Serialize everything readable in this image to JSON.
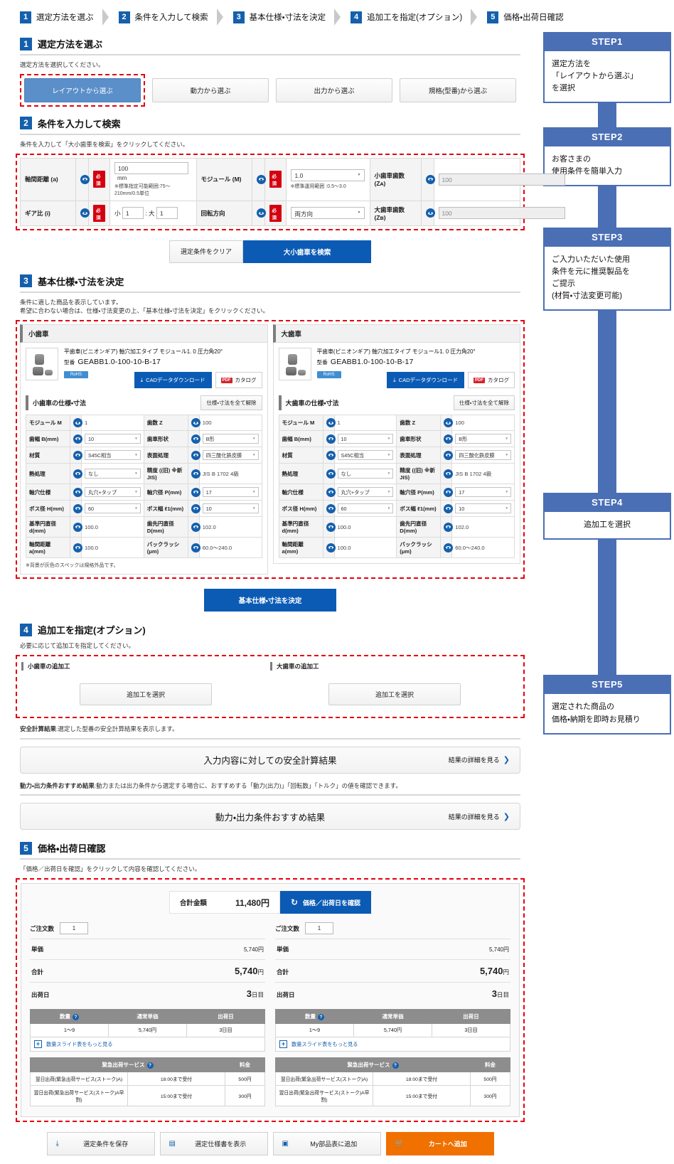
{
  "breadcrumb": {
    "steps": [
      {
        "num": "1",
        "label": "選定方法を選ぶ"
      },
      {
        "num": "2",
        "label": "条件を入力して検索"
      },
      {
        "num": "3",
        "label": "基本仕様・寸法を決定"
      },
      {
        "num": "4",
        "label": "追加工を指定(オプション)"
      },
      {
        "num": "5",
        "label": "価格・出荷日確認"
      }
    ]
  },
  "section1": {
    "num": "1",
    "title": "選定方法を選ぶ",
    "note": "選定方法を選択してください。",
    "methods": [
      {
        "label": "レイアウトから選ぶ",
        "selected": true
      },
      {
        "label": "動力から選ぶ",
        "selected": false
      },
      {
        "label": "出力から選ぶ",
        "selected": false
      },
      {
        "label": "規格(型番)から選ぶ",
        "selected": false
      }
    ]
  },
  "section2": {
    "num": "2",
    "title": "条件を入力して検索",
    "note": "条件を入力して「大小歯車を検索」をクリックしてください。",
    "required_badge": "必須",
    "fields": {
      "axis_distance": {
        "label": "軸間距離 (a)",
        "value": "100",
        "unit": "mm",
        "hint": "※標準指定可能範囲:75〜210mm/0.5単位"
      },
      "module": {
        "label": "モジュール (M)",
        "value": "1.0",
        "hint": "※標準運用範囲 :0.5〜3.0"
      },
      "small_teeth": {
        "label": "小歯車歯数 (Zᴀ)",
        "value": "100"
      },
      "gear_ratio": {
        "label": "ギア比 (i)",
        "small_prefix": "小",
        "small_value": "1",
        "sep": ": 大",
        "large_value": "1"
      },
      "rotation": {
        "label": "回転方向",
        "value": "両方向"
      },
      "large_teeth": {
        "label": "大歯車歯数 (Zʙ)",
        "value": "100"
      }
    },
    "buttons": {
      "clear": "選定条件をクリア",
      "search": "大小歯車を検索"
    }
  },
  "section3": {
    "num": "3",
    "title": "基本仕様・寸法を決定",
    "note_line1": "条件に適した商品を表示しています。",
    "note_line2": "希望に合わない場合は、仕様・寸法変更の上、「基本仕様・寸法を決定」をクリックください。",
    "decide_button": "基本仕様・寸法を決定",
    "footnote": "※背景が灰色のスペックは規格外品です。",
    "gears": [
      {
        "title": "小歯車",
        "desc": "平歯車(ピニオンギア) 軸穴加工タイプ モジュール1. 0 圧力角20°",
        "model_label": "型番",
        "model": "GEABB1.0-100-10-B-17",
        "rohs": "RoHS",
        "cad_button": "CADデータダウンロード",
        "catalog_button": "カタログ",
        "spec_title": "小歯車の仕様・寸法",
        "clear_spec": "仕様・寸法を全て解除",
        "specs": [
          {
            "l_label": "モジュール M",
            "l_value": "1",
            "l_type": "text",
            "r_label": "歯数 Z",
            "r_value": "100",
            "r_type": "text"
          },
          {
            "l_label": "歯幅 B(mm)",
            "l_value": "10",
            "l_type": "select",
            "r_label": "歯車形状",
            "r_value": "B形",
            "r_type": "select"
          },
          {
            "l_label": "材質",
            "l_value": "S45C相当",
            "l_type": "select",
            "r_label": "表面処理",
            "r_value": "四三酸化鉄皮膜",
            "r_type": "select"
          },
          {
            "l_label": "熱処理",
            "l_value": "なし",
            "l_type": "select",
            "r_label": "精度 ((旧) ※新JIS)",
            "r_value": "JIS B 1702 4級",
            "r_type": "text"
          },
          {
            "l_label": "軸穴仕様",
            "l_value": "丸穴+タップ",
            "l_type": "select",
            "r_label": "軸穴径 P(mm)",
            "r_value": "17",
            "r_type": "select"
          },
          {
            "l_label": "ボス径 H(mm)",
            "l_value": "60",
            "l_type": "select",
            "r_label": "ボス幅 ℓ1(mm)",
            "r_value": "10",
            "r_type": "select"
          },
          {
            "l_label": "基準円直径 d(mm)",
            "l_value": "100.0",
            "l_type": "text",
            "r_label": "歯先円直径 D(mm)",
            "r_value": "102.0",
            "r_type": "text"
          },
          {
            "l_label": "軸間距離 a(mm)",
            "l_value": "100.0",
            "l_type": "text",
            "r_label": "バックラッシ (μm)",
            "r_value": "60.0〜240.0",
            "r_type": "text"
          }
        ]
      },
      {
        "title": "大歯車",
        "desc": "平歯車(ピニオンギア) 軸穴加工タイプ モジュール1. 0 圧力角20°",
        "model_label": "型番",
        "model": "GEABB1.0-100-10-B-17",
        "rohs": "RoHS",
        "cad_button": "CADデータダウンロード",
        "catalog_button": "カタログ",
        "spec_title": "大歯車の仕様・寸法",
        "clear_spec": "仕様・寸法を全て解除",
        "specs": [
          {
            "l_label": "モジュール M",
            "l_value": "1",
            "l_type": "text",
            "r_label": "歯数 Z",
            "r_value": "100",
            "r_type": "text"
          },
          {
            "l_label": "歯幅 B(mm)",
            "l_value": "10",
            "l_type": "select",
            "r_label": "歯車形状",
            "r_value": "B形",
            "r_type": "select"
          },
          {
            "l_label": "材質",
            "l_value": "S45C相当",
            "l_type": "select",
            "r_label": "表面処理",
            "r_value": "四三酸化鉄皮膜",
            "r_type": "select"
          },
          {
            "l_label": "熱処理",
            "l_value": "なし",
            "l_type": "select",
            "r_label": "精度 ((旧) ※新JIS)",
            "r_value": "JIS B 1702 4級",
            "r_type": "text"
          },
          {
            "l_label": "軸穴仕様",
            "l_value": "丸穴+タップ",
            "l_type": "select",
            "r_label": "軸穴径 P(mm)",
            "r_value": "17",
            "r_type": "select"
          },
          {
            "l_label": "ボス径 H(mm)",
            "l_value": "60",
            "l_type": "select",
            "r_label": "ボス幅 ℓ1(mm)",
            "r_value": "10",
            "r_type": "select"
          },
          {
            "l_label": "基準円直径 d(mm)",
            "l_value": "100.0",
            "l_type": "text",
            "r_label": "歯先円直径 D(mm)",
            "r_value": "102.0",
            "r_type": "text"
          },
          {
            "l_label": "軸間距離 a(mm)",
            "l_value": "100.0",
            "l_type": "text",
            "r_label": "バックラッシ (μm)",
            "r_value": "60.0〜240.0",
            "r_type": "text"
          }
        ]
      }
    ]
  },
  "section4": {
    "num": "4",
    "title": "追加工を指定(オプション)",
    "note": "必要に応じて追加工を指定してください。",
    "small_title": "小歯車の追加工",
    "large_title": "大歯車の追加工",
    "select_button": "追加工を選択"
  },
  "results": {
    "safety_note_bold": "安全計算結果",
    "safety_note_rest": ":選定した型番の安全計算結果を表示します。",
    "safety_title": "入力内容に対しての安全計算結果",
    "safety_more": "結果の詳細を見る",
    "power_note_bold": "動力・出力条件おすすめ結果",
    "power_note_rest": ":動力または出力条件から選定する場合に、おすすめする「動力(出力)」「回転数」「トルク」の値を確認できます。",
    "power_title": "動力・出力条件おすすめ結果",
    "power_more": "結果の詳細を見る"
  },
  "section5": {
    "num": "5",
    "title": "価格・出荷日確認",
    "note": "「価格／出荷日を確認」をクリックして内容を確認してください。",
    "total_label": "合計金額",
    "total_value": "11,480円",
    "confirm_button": "価格／出荷日を確認",
    "columns": [
      {
        "qty_label": "ご注文数",
        "qty_value": "1",
        "unit_price_label": "単価",
        "unit_price_value": "5,740円",
        "subtotal_label": "合計",
        "subtotal_value": "5,740",
        "subtotal_unit": "円",
        "ship_label": "出荷日",
        "ship_value": "3",
        "ship_unit": "日目",
        "slide_headers": [
          "数量",
          "通常単価",
          "出荷日"
        ],
        "slide_rows": [
          [
            "1〜9",
            "5,740円",
            "3日目"
          ]
        ],
        "more_label": "数量スライド表をもっと見る",
        "svc_header": "緊急出荷サービス",
        "svc_fee_header": "料金",
        "svc_rows": [
          [
            "翌日出荷(緊急出荷サービス(ストーク)A)",
            "18:00まで受付",
            "500円"
          ],
          [
            "翌日出荷(緊急出荷サービス(ストーク)A早割)",
            "15:00まで受付",
            "300円"
          ]
        ]
      },
      {
        "qty_label": "ご注文数",
        "qty_value": "1",
        "unit_price_label": "単価",
        "unit_price_value": "5,740円",
        "subtotal_label": "合計",
        "subtotal_value": "5,740",
        "subtotal_unit": "円",
        "ship_label": "出荷日",
        "ship_value": "3",
        "ship_unit": "日目",
        "slide_headers": [
          "数量",
          "通常単価",
          "出荷日"
        ],
        "slide_rows": [
          [
            "1〜9",
            "5,740円",
            "3日目"
          ]
        ],
        "more_label": "数量スライド表をもっと見る",
        "svc_header": "緊急出荷サービス",
        "svc_fee_header": "料金",
        "svc_rows": [
          [
            "翌日出荷(緊急出荷サービス(ストーク)A)",
            "18:00まで受付",
            "500円"
          ],
          [
            "翌日出荷(緊急出荷サービス(ストーク)A早割)",
            "15:00まで受付",
            "300円"
          ]
        ]
      }
    ]
  },
  "bottom_buttons": [
    {
      "label": "選定条件を保存",
      "icon": "download-icon",
      "glyph": "⤓",
      "primary": false
    },
    {
      "label": "選定仕様書を表示",
      "icon": "document-icon",
      "glyph": "▤",
      "primary": false
    },
    {
      "label": "My部品表に追加",
      "icon": "add-list-icon",
      "glyph": "▣",
      "primary": false
    },
    {
      "label": "カートへ追加",
      "icon": "cart-icon",
      "glyph": "🛒",
      "primary": true
    }
  ],
  "side_steps": [
    {
      "head": "STEP1",
      "body": "選定方法を\n「レイアウトから選ぶ」\nを選択"
    },
    {
      "head": "STEP2",
      "body": "お客さまの\n使用条件を簡単入力"
    },
    {
      "head": "STEP3",
      "body": "ご入力いただいた使用\n条件を元に推奨製品を\nご提示\n(材質・寸法変更可能)"
    },
    {
      "head": "STEP4",
      "body": "追加工を選択"
    },
    {
      "head": "STEP5",
      "body": "選定された商品の\n価格・納期を即時お見積り"
    }
  ],
  "colors": {
    "accent_blue": "#0b5bb5",
    "step_blue": "#4a6fb5",
    "required_red": "#d4000f",
    "cart_orange": "#f07000",
    "dashed_red": "#e3000f"
  }
}
